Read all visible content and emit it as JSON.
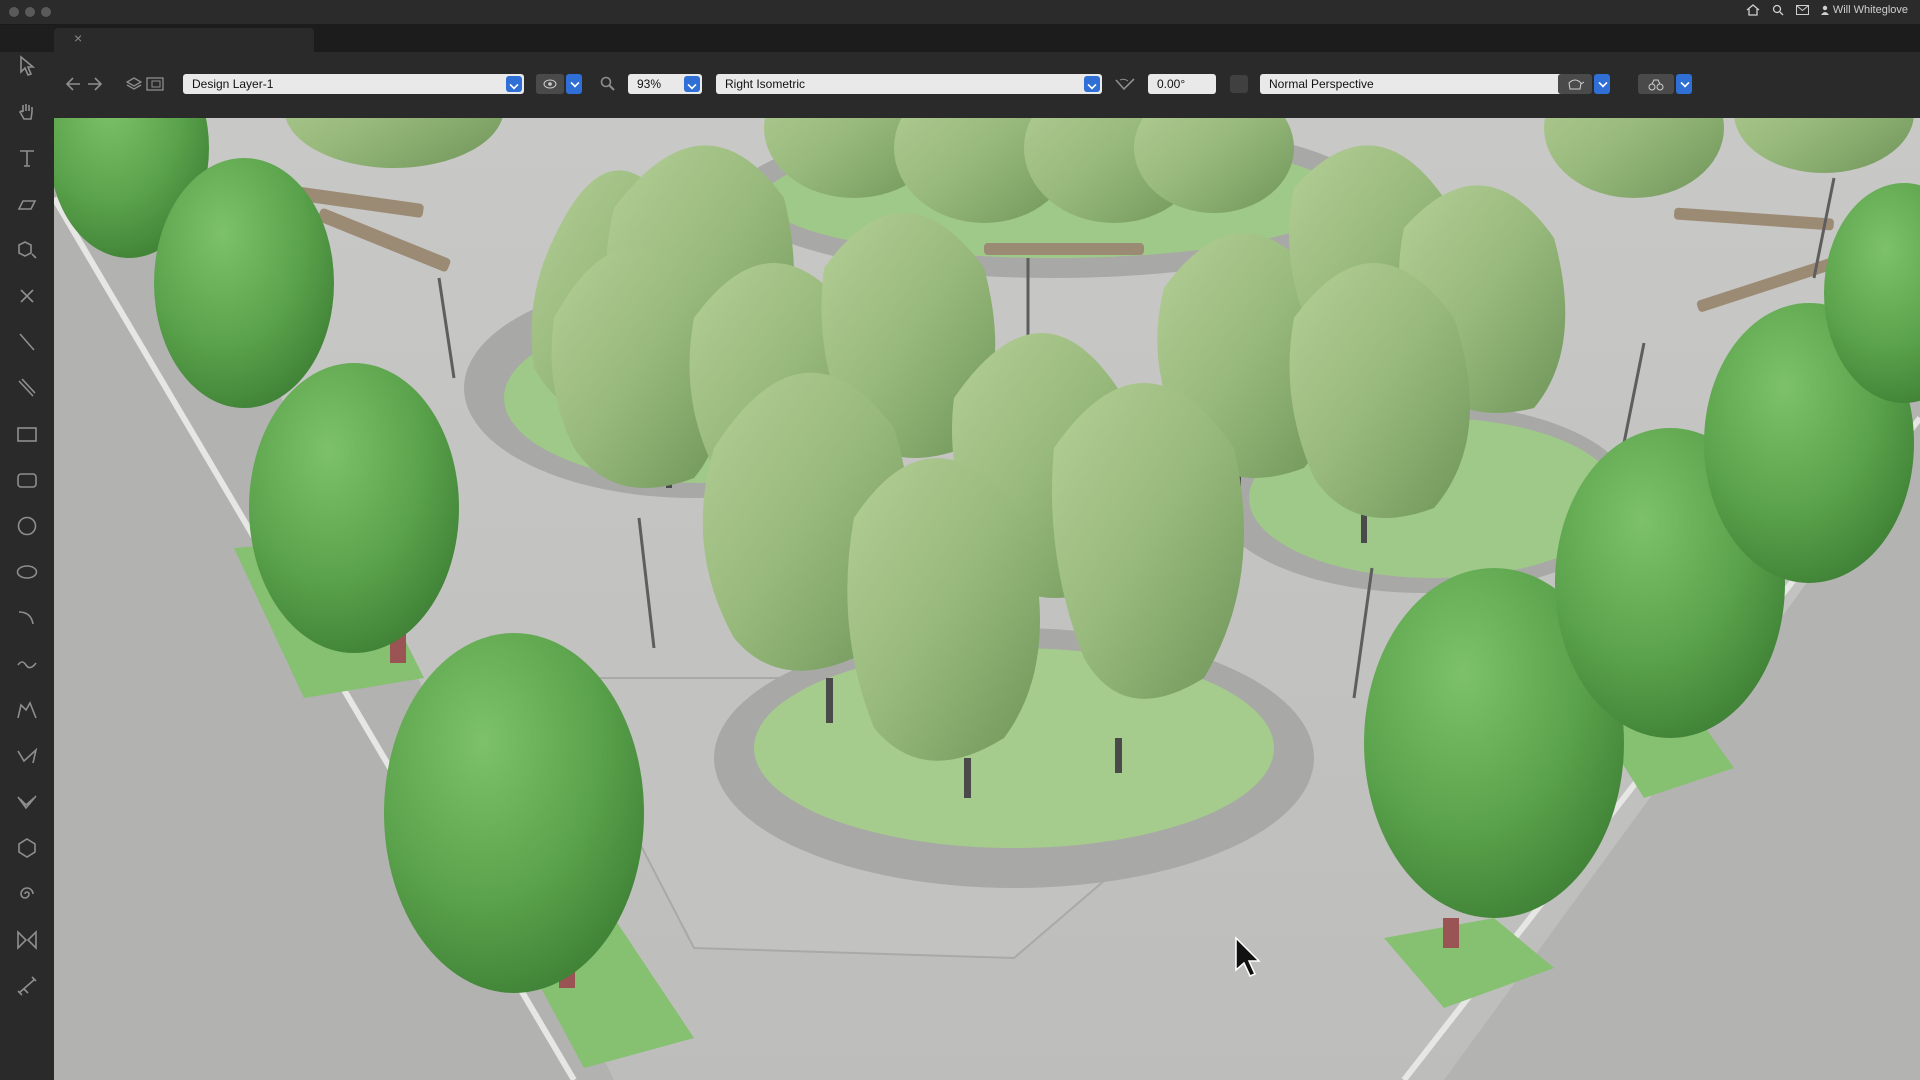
{
  "window": {
    "status_user": "Will Whiteglove"
  },
  "toolbar": {
    "layer": "Design Layer-1",
    "zoom": "93%",
    "view": "Right Isometric",
    "rotation": "0.00°",
    "projection": "Normal Perspective"
  },
  "tools": [
    "selection-tool-icon",
    "pan-tool-icon",
    "text-tool-icon",
    "callout-tool-icon",
    "attribute-tool-icon",
    "x-tool-icon",
    "line-tool-icon",
    "double-line-tool-icon",
    "rectangle-tool-icon",
    "rounded-rectangle-tool-icon",
    "circle-tool-icon",
    "oval-tool-icon",
    "arc-tool-icon",
    "freehand-tool-icon",
    "polyline-tool-icon",
    "polygon-tool-icon",
    "double-line-polygon-tool-icon",
    "regular-polygon-tool-icon",
    "spiral-tool-icon",
    "mirror-tool-icon",
    "dimension-tool-icon"
  ],
  "colors": {
    "accent": "#2f6fd6",
    "ground": "#bcbcbc",
    "path": "#c9c9c7",
    "tree_light": "#98b97c",
    "tree_dark": "#5fa54f",
    "lawn": "#9fc988"
  }
}
